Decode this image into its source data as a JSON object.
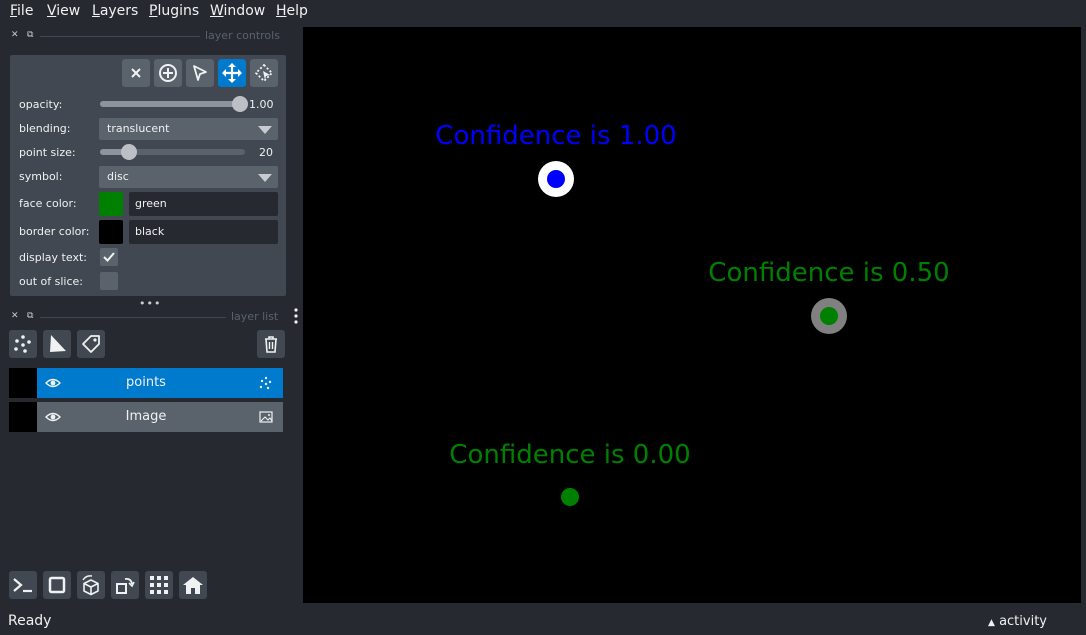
{
  "menu": [
    "File",
    "View",
    "Layers",
    "Plugins",
    "Window",
    "Help"
  ],
  "controls_dock": {
    "title": "layer controls"
  },
  "controls": {
    "opacity": {
      "label": "opacity:",
      "value": "1.00",
      "level": 1.0
    },
    "blending": {
      "label": "blending:",
      "value": "translucent"
    },
    "point_size": {
      "label": "point size:",
      "value": "20",
      "level": 0.2
    },
    "symbol": {
      "label": "symbol:",
      "value": "disc"
    },
    "face_color": {
      "label": "face color:",
      "value": "green",
      "swatch": "#008000"
    },
    "border_color": {
      "label": "border color:",
      "value": "black",
      "swatch": "#000000"
    },
    "display_text": {
      "label": "display text:",
      "checked": true
    },
    "out_of_slice": {
      "label": "out of slice:",
      "checked": false
    }
  },
  "tools": [
    {
      "icon": "close-icon"
    },
    {
      "icon": "add-point-icon"
    },
    {
      "icon": "select-arrow-icon"
    },
    {
      "icon": "pan-zoom-icon",
      "active": true
    },
    {
      "icon": "transform-icon"
    }
  ],
  "list_dock": {
    "title": "layer list"
  },
  "layers": [
    {
      "name": "points",
      "type": "points",
      "selected": true
    },
    {
      "name": "Image",
      "type": "image",
      "selected": false
    }
  ],
  "canvas": {
    "points": [
      {
        "label": "Confidence is 1.00",
        "label_color": "#0000ff",
        "face": "#0000ff",
        "border": "#ffffff"
      },
      {
        "label": "Confidence is 0.50",
        "label_color": "#008000",
        "face": "#008000",
        "border": "#808080"
      },
      {
        "label": "Confidence is 0.00",
        "label_color": "#008000",
        "face": "#008000",
        "border": "#000000"
      }
    ]
  },
  "status": {
    "left": "Ready",
    "right": "activity"
  },
  "colors": {
    "accent": "#007acc",
    "panel": "#414851",
    "background": "#262930"
  }
}
